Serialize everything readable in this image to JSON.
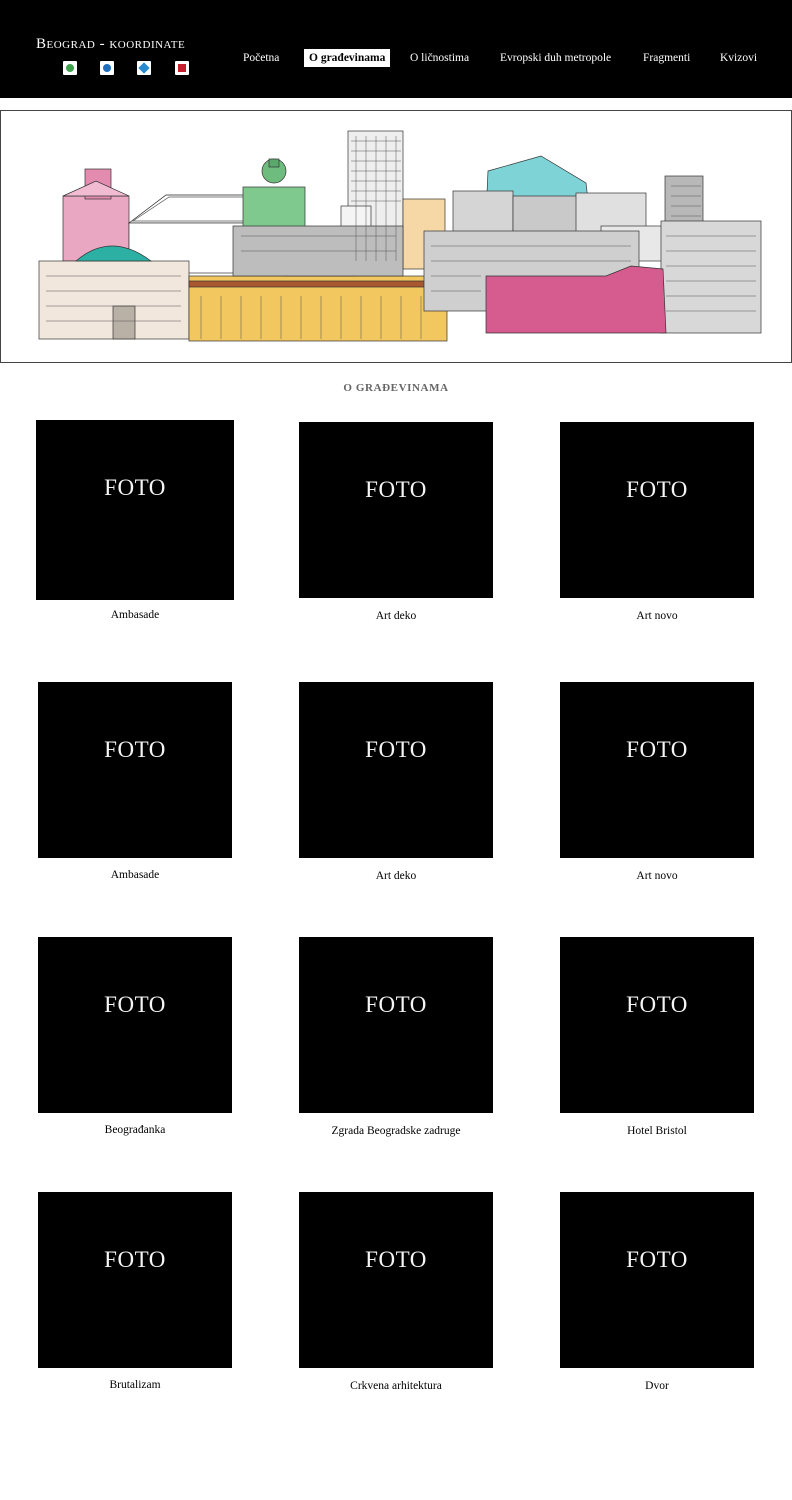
{
  "header": {
    "brand": "Beograd - koordinate",
    "flags": [
      {
        "name": "flag-1-icon",
        "color": "#3fa34d"
      },
      {
        "name": "flag-2-icon",
        "color": "#1f6fbf"
      },
      {
        "name": "flag-3-icon",
        "color": "#2a8ad0"
      },
      {
        "name": "flag-4-icon",
        "color": "#c8202b"
      }
    ],
    "nav": [
      {
        "label": "Početna",
        "active": false
      },
      {
        "label": "O građevinama",
        "active": true
      },
      {
        "label": "O ličnostima",
        "active": false
      },
      {
        "label": "Evropski duh metropole",
        "active": false
      },
      {
        "label": "Fragmenti",
        "active": false
      },
      {
        "label": "Kvizovi",
        "active": false
      }
    ]
  },
  "section": {
    "title": "O GRAĐEVINAMA"
  },
  "tiles": [
    {
      "photo": "FOTO",
      "caption": "Ambasade"
    },
    {
      "photo": "FOTO",
      "caption": "Art deko"
    },
    {
      "photo": "FOTO",
      "caption": "Art novo"
    },
    {
      "photo": "FOTO",
      "caption": "Ambasade"
    },
    {
      "photo": "FOTO",
      "caption": "Art deko"
    },
    {
      "photo": "FOTO",
      "caption": "Art novo"
    },
    {
      "photo": "FOTO",
      "caption": "Beograđanka"
    },
    {
      "photo": "FOTO",
      "caption": "Zgrada Beogradske zadruge"
    },
    {
      "photo": "FOTO",
      "caption": "Hotel Bristol"
    },
    {
      "photo": "FOTO",
      "caption": "Brutalizam"
    },
    {
      "photo": "FOTO",
      "caption": "Crkvena arhitektura"
    },
    {
      "photo": "FOTO",
      "caption": "Dvor"
    }
  ]
}
